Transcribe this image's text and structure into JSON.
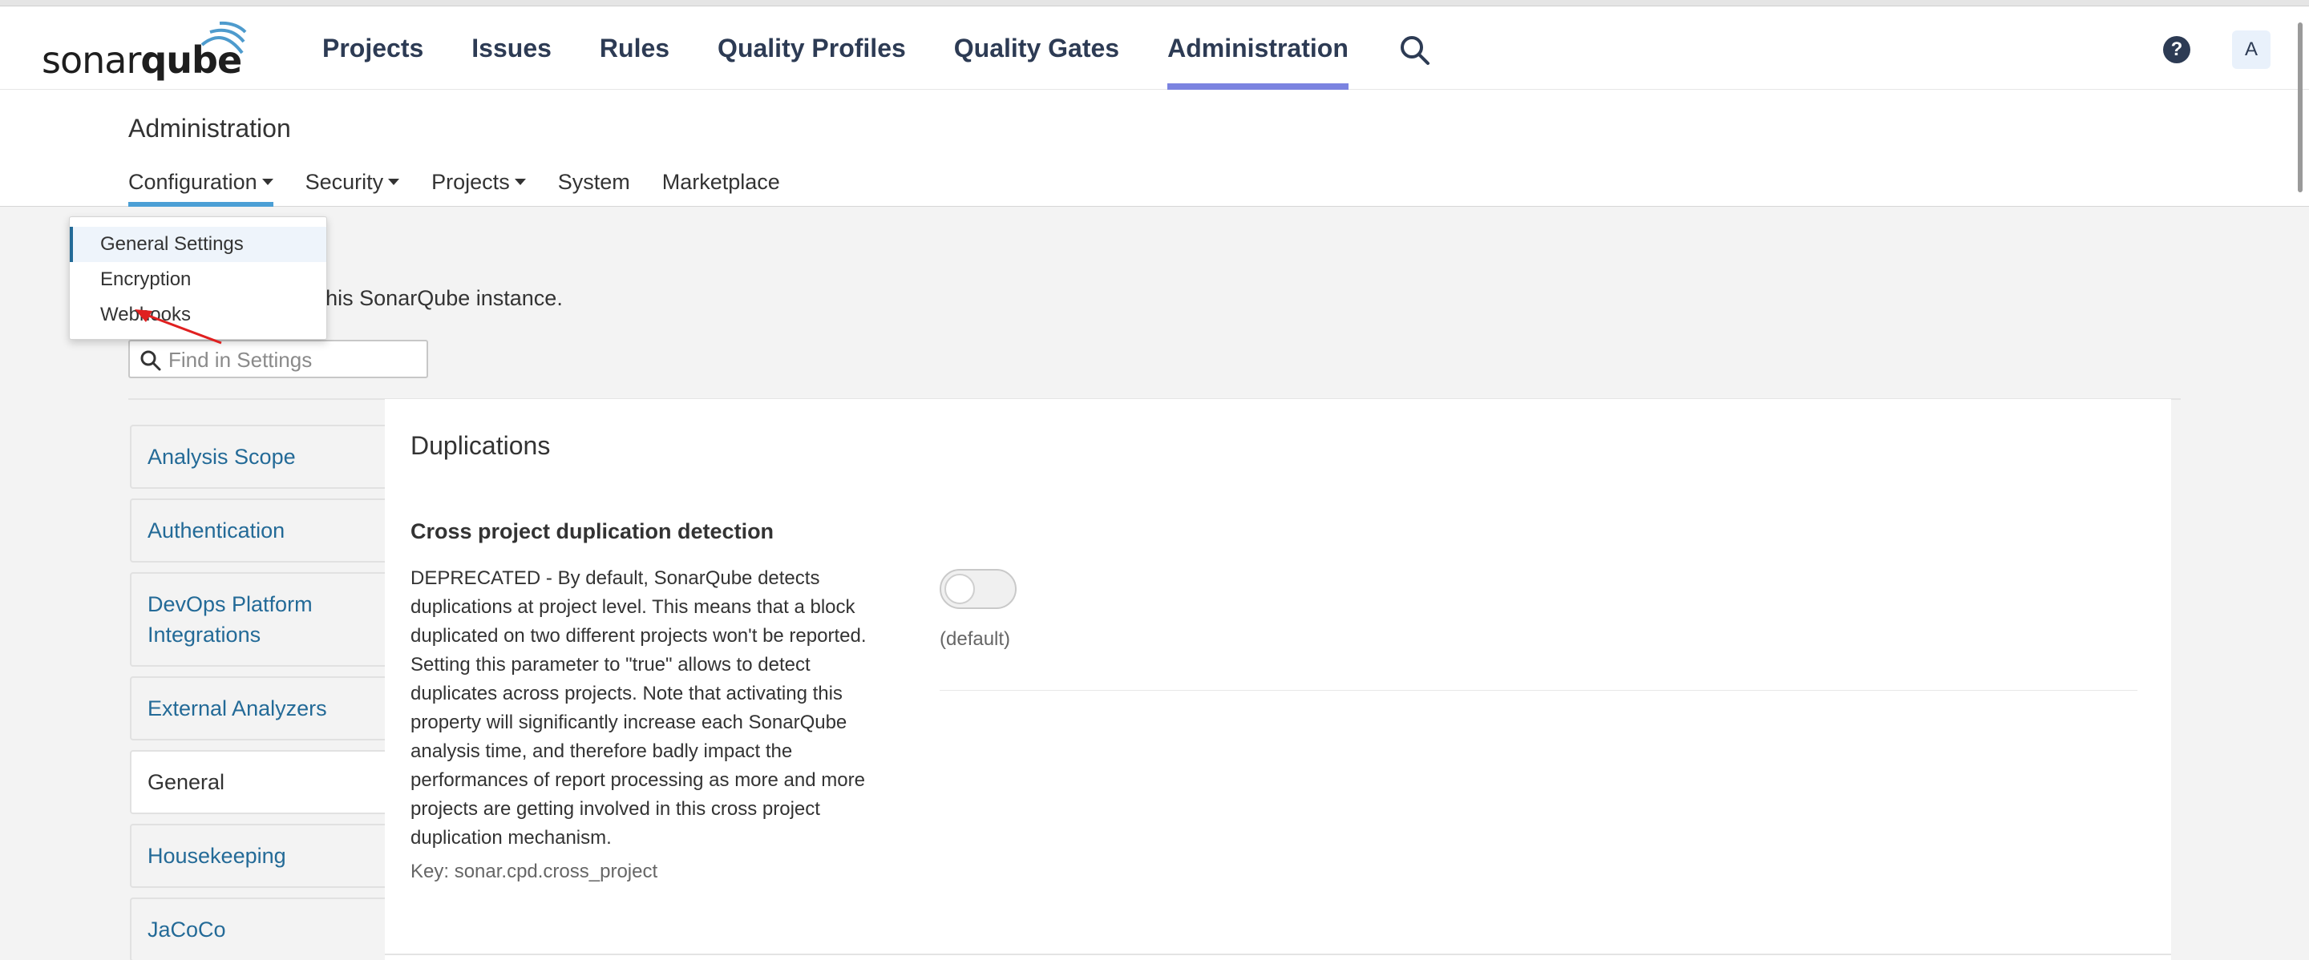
{
  "app": {
    "logo_text_regular": "sonar",
    "logo_text_bold": "qube"
  },
  "topnav": {
    "items": [
      "Projects",
      "Issues",
      "Rules",
      "Quality Profiles",
      "Quality Gates",
      "Administration"
    ],
    "active": "Administration",
    "help_label": "?",
    "avatar_letter": "A"
  },
  "page": {
    "title": "Administration",
    "subnav": {
      "configuration": "Configuration",
      "security": "Security",
      "projects": "Projects",
      "system": "System",
      "marketplace": "Marketplace"
    },
    "description_visible": "r this SonarQube instance.",
    "search": {
      "placeholder": "Find in Settings",
      "value": ""
    }
  },
  "dropdown": {
    "items": [
      "General Settings",
      "Encryption",
      "Webhooks"
    ],
    "active": "General Settings"
  },
  "categories": [
    "Analysis Scope",
    "Authentication",
    "DevOps Platform Integrations",
    "External Analyzers",
    "General",
    "Housekeeping",
    "JaCoCo"
  ],
  "active_category": "General",
  "section": {
    "title": "Duplications",
    "setting": {
      "title": "Cross project duplication detection",
      "description": "DEPRECATED - By default, SonarQube detects duplications at project level. This means that a block duplicated on two different projects won't be reported. Setting this parameter to \"true\" allows to detect duplicates across projects. Note that activating this property will significantly increase each SonarQube analysis time, and therefore badly impact the performances of report processing as more and more projects are getting involved in this cross project duplication mechanism.",
      "key_label": "Key: sonar.cpd.cross_project",
      "value": false,
      "default_label": "(default)"
    }
  },
  "colors": {
    "nav_text": "#2d3b54",
    "active_underline": "#7b83e0",
    "link_blue": "#236a97",
    "subnav_underline": "#4b9fd5",
    "annotation_arrow": "#e02020"
  }
}
